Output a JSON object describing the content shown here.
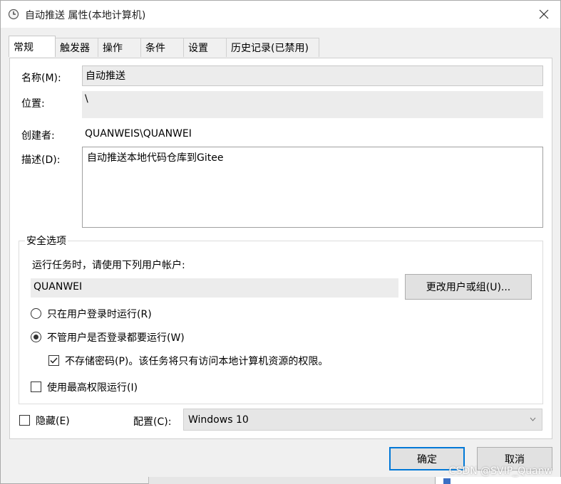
{
  "window": {
    "title": "自动推送 属性(本地计算机)",
    "title_icon": "clock-icon",
    "close_icon": "close-icon"
  },
  "tabs": [
    {
      "label": "常规",
      "active": true
    },
    {
      "label": "触发器"
    },
    {
      "label": "操作"
    },
    {
      "label": "条件"
    },
    {
      "label": "设置"
    },
    {
      "label": "历史记录(已禁用)"
    }
  ],
  "general": {
    "name_label": "名称(M):",
    "name_value": "自动推送",
    "location_label": "位置:",
    "location_value": "\\",
    "author_label": "创建者:",
    "author_value": "QUANWEIS\\QUANWEI",
    "description_label": "描述(D):",
    "description_value": "自动推送本地代码仓库到Gitee"
  },
  "security": {
    "group_title": "安全选项",
    "run_as_prompt": "运行任务时，请使用下列用户帐户:",
    "user_account": "QUANWEI",
    "change_user_button": "更改用户或组(U)...",
    "radio_logged_on": "只在用户登录时运行(R)",
    "radio_logged_on_checked": false,
    "radio_any": "不管用户是否登录都要运行(W)",
    "radio_any_checked": true,
    "no_store_password": "不存储密码(P)。该任务将只有访问本地计算机资源的权限。",
    "no_store_password_checked": true,
    "highest_privileges": "使用最高权限运行(I)",
    "highest_privileges_checked": false
  },
  "footer": {
    "hidden_label": "隐藏(E)",
    "hidden_checked": false,
    "config_label": "配置(C):",
    "config_value": "Windows 10",
    "ok_button": "确定",
    "cancel_button": "取消"
  },
  "watermark": "CSDN @SVIP_Quanw",
  "colors": {
    "accent": "#0078d7",
    "panel_bg": "#ffffff",
    "dialog_bg": "#f0f0f0",
    "readonly_bg": "#ececec"
  }
}
